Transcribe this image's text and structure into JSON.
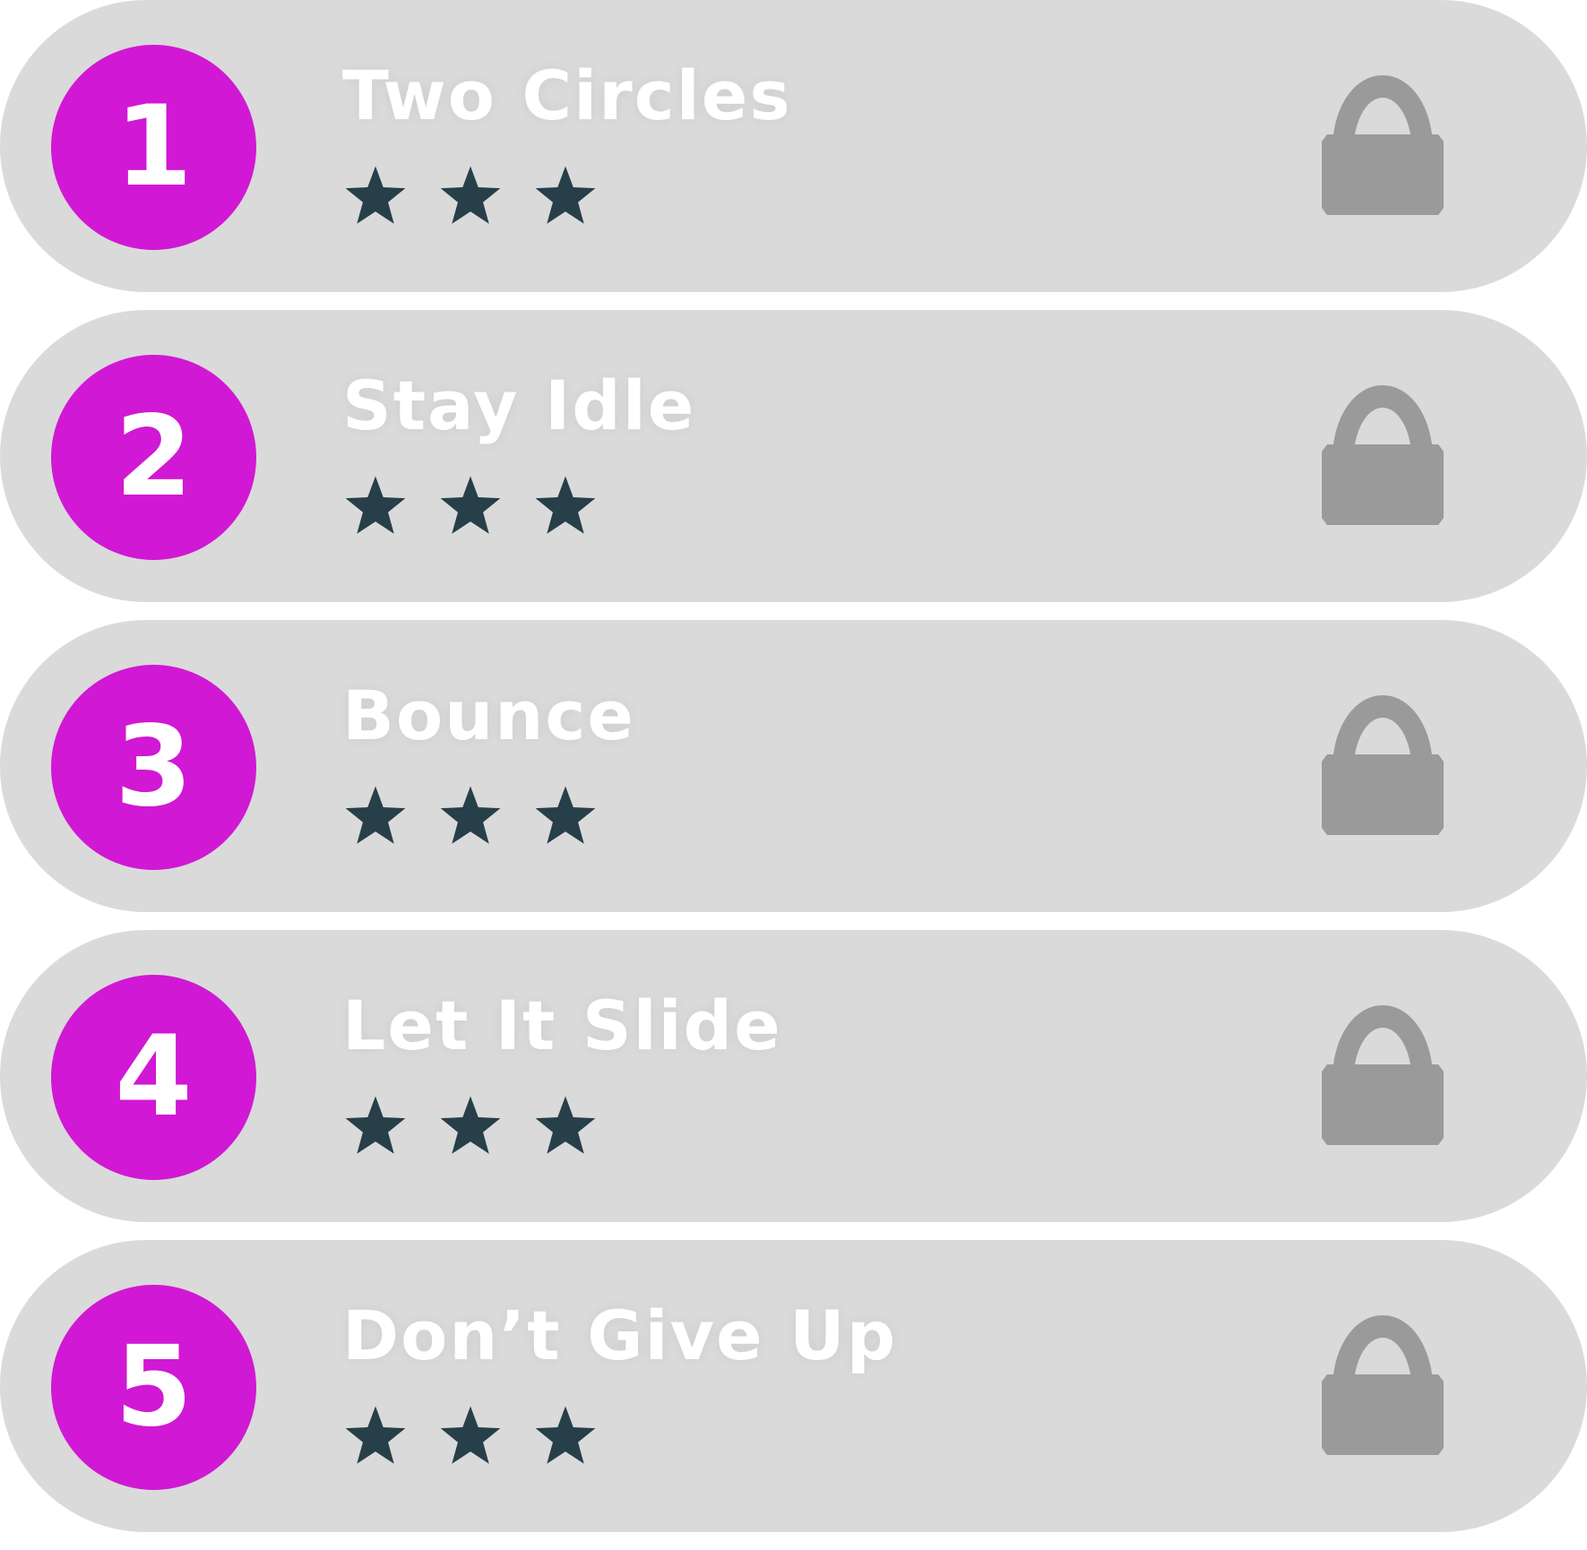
{
  "colors": {
    "row_background": "#dadada",
    "badge": "#d118d4",
    "star": "#263f49",
    "lock": "#9a9a9a",
    "text": "#ffffff"
  },
  "levels": [
    {
      "number": "1",
      "title": "Two Circles",
      "stars": 3,
      "locked": true,
      "star_icon": "star-icon",
      "lock_icon": "lock-icon"
    },
    {
      "number": "2",
      "title": "Stay Idle",
      "stars": 3,
      "locked": true,
      "star_icon": "star-icon",
      "lock_icon": "lock-icon"
    },
    {
      "number": "3",
      "title": "Bounce",
      "stars": 3,
      "locked": true,
      "star_icon": "star-icon",
      "lock_icon": "lock-icon"
    },
    {
      "number": "4",
      "title": "Let It Slide",
      "stars": 3,
      "locked": true,
      "star_icon": "star-icon",
      "lock_icon": "lock-icon"
    },
    {
      "number": "5",
      "title": "Don’t Give Up",
      "stars": 3,
      "locked": true,
      "star_icon": "star-icon",
      "lock_icon": "lock-icon"
    }
  ]
}
